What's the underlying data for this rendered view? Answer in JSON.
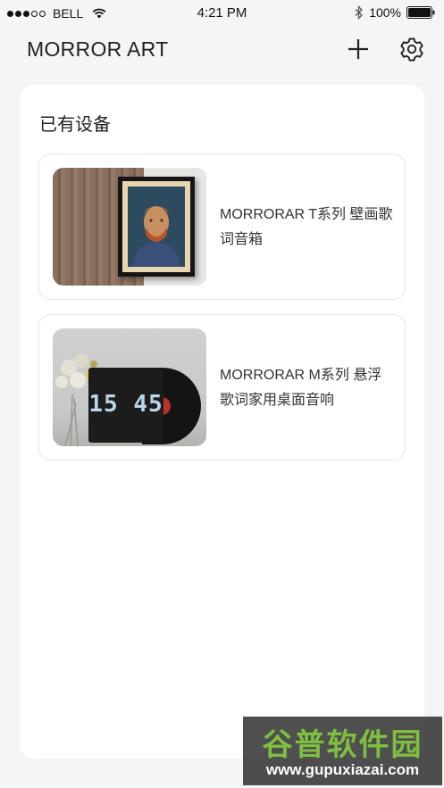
{
  "status_bar": {
    "carrier": "BELL",
    "time": "4:21 PM",
    "battery": "100%"
  },
  "header": {
    "title": "MORROR ART",
    "add_icon": "plus-icon",
    "settings_icon": "gear-icon"
  },
  "main": {
    "section_title": "已有设备",
    "devices": [
      {
        "name": "MORRORAR T系列 壁画歌词音箱",
        "thumbnail": "framed-portrait-on-wood-wall"
      },
      {
        "name": "MORRORAR M系列 悬浮歌词家用桌面音响",
        "thumbnail": "clock-speaker-with-vinyl",
        "clock_text": "15 45"
      }
    ]
  },
  "watermark": {
    "text": "谷普软件园",
    "url": "www.gupuxiazai.com"
  },
  "colors": {
    "background": "#f4f5f7",
    "card": "#ffffff",
    "watermark_green": "#7fbf3f"
  }
}
